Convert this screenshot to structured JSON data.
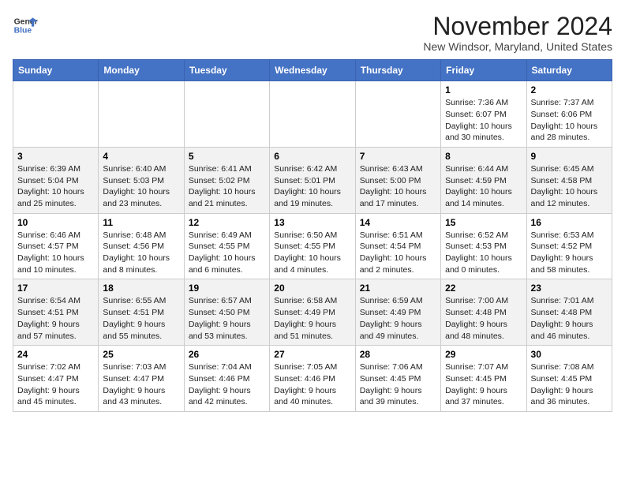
{
  "logo": {
    "line1": "General",
    "line2": "Blue"
  },
  "title": "November 2024",
  "subtitle": "New Windsor, Maryland, United States",
  "weekdays": [
    "Sunday",
    "Monday",
    "Tuesday",
    "Wednesday",
    "Thursday",
    "Friday",
    "Saturday"
  ],
  "weeks": [
    [
      {
        "day": "",
        "info": ""
      },
      {
        "day": "",
        "info": ""
      },
      {
        "day": "",
        "info": ""
      },
      {
        "day": "",
        "info": ""
      },
      {
        "day": "",
        "info": ""
      },
      {
        "day": "1",
        "info": "Sunrise: 7:36 AM\nSunset: 6:07 PM\nDaylight: 10 hours and 30 minutes."
      },
      {
        "day": "2",
        "info": "Sunrise: 7:37 AM\nSunset: 6:06 PM\nDaylight: 10 hours and 28 minutes."
      }
    ],
    [
      {
        "day": "3",
        "info": "Sunrise: 6:39 AM\nSunset: 5:04 PM\nDaylight: 10 hours and 25 minutes."
      },
      {
        "day": "4",
        "info": "Sunrise: 6:40 AM\nSunset: 5:03 PM\nDaylight: 10 hours and 23 minutes."
      },
      {
        "day": "5",
        "info": "Sunrise: 6:41 AM\nSunset: 5:02 PM\nDaylight: 10 hours and 21 minutes."
      },
      {
        "day": "6",
        "info": "Sunrise: 6:42 AM\nSunset: 5:01 PM\nDaylight: 10 hours and 19 minutes."
      },
      {
        "day": "7",
        "info": "Sunrise: 6:43 AM\nSunset: 5:00 PM\nDaylight: 10 hours and 17 minutes."
      },
      {
        "day": "8",
        "info": "Sunrise: 6:44 AM\nSunset: 4:59 PM\nDaylight: 10 hours and 14 minutes."
      },
      {
        "day": "9",
        "info": "Sunrise: 6:45 AM\nSunset: 4:58 PM\nDaylight: 10 hours and 12 minutes."
      }
    ],
    [
      {
        "day": "10",
        "info": "Sunrise: 6:46 AM\nSunset: 4:57 PM\nDaylight: 10 hours and 10 minutes."
      },
      {
        "day": "11",
        "info": "Sunrise: 6:48 AM\nSunset: 4:56 PM\nDaylight: 10 hours and 8 minutes."
      },
      {
        "day": "12",
        "info": "Sunrise: 6:49 AM\nSunset: 4:55 PM\nDaylight: 10 hours and 6 minutes."
      },
      {
        "day": "13",
        "info": "Sunrise: 6:50 AM\nSunset: 4:55 PM\nDaylight: 10 hours and 4 minutes."
      },
      {
        "day": "14",
        "info": "Sunrise: 6:51 AM\nSunset: 4:54 PM\nDaylight: 10 hours and 2 minutes."
      },
      {
        "day": "15",
        "info": "Sunrise: 6:52 AM\nSunset: 4:53 PM\nDaylight: 10 hours and 0 minutes."
      },
      {
        "day": "16",
        "info": "Sunrise: 6:53 AM\nSunset: 4:52 PM\nDaylight: 9 hours and 58 minutes."
      }
    ],
    [
      {
        "day": "17",
        "info": "Sunrise: 6:54 AM\nSunset: 4:51 PM\nDaylight: 9 hours and 57 minutes."
      },
      {
        "day": "18",
        "info": "Sunrise: 6:55 AM\nSunset: 4:51 PM\nDaylight: 9 hours and 55 minutes."
      },
      {
        "day": "19",
        "info": "Sunrise: 6:57 AM\nSunset: 4:50 PM\nDaylight: 9 hours and 53 minutes."
      },
      {
        "day": "20",
        "info": "Sunrise: 6:58 AM\nSunset: 4:49 PM\nDaylight: 9 hours and 51 minutes."
      },
      {
        "day": "21",
        "info": "Sunrise: 6:59 AM\nSunset: 4:49 PM\nDaylight: 9 hours and 49 minutes."
      },
      {
        "day": "22",
        "info": "Sunrise: 7:00 AM\nSunset: 4:48 PM\nDaylight: 9 hours and 48 minutes."
      },
      {
        "day": "23",
        "info": "Sunrise: 7:01 AM\nSunset: 4:48 PM\nDaylight: 9 hours and 46 minutes."
      }
    ],
    [
      {
        "day": "24",
        "info": "Sunrise: 7:02 AM\nSunset: 4:47 PM\nDaylight: 9 hours and 45 minutes."
      },
      {
        "day": "25",
        "info": "Sunrise: 7:03 AM\nSunset: 4:47 PM\nDaylight: 9 hours and 43 minutes."
      },
      {
        "day": "26",
        "info": "Sunrise: 7:04 AM\nSunset: 4:46 PM\nDaylight: 9 hours and 42 minutes."
      },
      {
        "day": "27",
        "info": "Sunrise: 7:05 AM\nSunset: 4:46 PM\nDaylight: 9 hours and 40 minutes."
      },
      {
        "day": "28",
        "info": "Sunrise: 7:06 AM\nSunset: 4:45 PM\nDaylight: 9 hours and 39 minutes."
      },
      {
        "day": "29",
        "info": "Sunrise: 7:07 AM\nSunset: 4:45 PM\nDaylight: 9 hours and 37 minutes."
      },
      {
        "day": "30",
        "info": "Sunrise: 7:08 AM\nSunset: 4:45 PM\nDaylight: 9 hours and 36 minutes."
      }
    ]
  ]
}
